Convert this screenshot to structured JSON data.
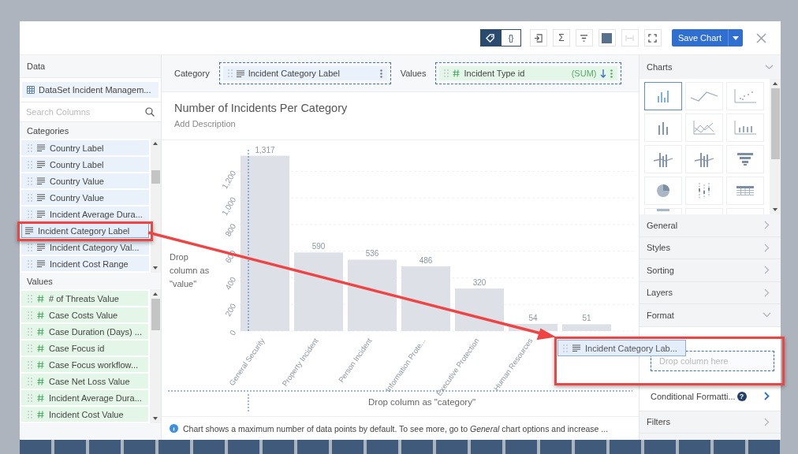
{
  "toolbar": {
    "view_toggle": [
      {
        "kind": "tag",
        "selected": true
      },
      {
        "kind": "braces",
        "label": "{}",
        "selected": false
      }
    ],
    "tools": [
      {
        "kind": "export",
        "disabled": false
      },
      {
        "kind": "sum",
        "label": "Σ",
        "disabled": false
      },
      {
        "kind": "filter",
        "disabled": false
      },
      {
        "kind": "color",
        "disabled": false
      },
      {
        "kind": "width",
        "disabled": true
      },
      {
        "kind": "fullscreen",
        "disabled": false
      }
    ],
    "save_button": "Save Chart"
  },
  "data_panel": {
    "title": "Data",
    "dataset": "DataSet Incident Managem...",
    "search": {
      "placeholder": "Search Columns"
    },
    "categories_heading": "Categories",
    "categories": [
      {
        "label": "Country Label",
        "selected": false
      },
      {
        "label": "Country Label",
        "selected": false
      },
      {
        "label": "Country Value",
        "selected": false
      },
      {
        "label": "Country Value",
        "selected": false
      },
      {
        "label": "Incident Average Dura...",
        "selected": false
      },
      {
        "label": "Incident Category Label",
        "selected": true
      },
      {
        "label": "Incident Category Val...",
        "selected": false
      },
      {
        "label": "Incident Cost Range",
        "selected": false
      }
    ],
    "values_heading": "Values",
    "values": [
      {
        "label": "# of Threats Value",
        "selected": false
      },
      {
        "label": "Case Costs Value",
        "selected": false
      },
      {
        "label": "Case Duration (Days) ...",
        "selected": false
      },
      {
        "label": "Case Focus id",
        "selected": false
      },
      {
        "label": "Case Focus workflow...",
        "selected": false
      },
      {
        "label": "Case Net Loss Value",
        "selected": false
      },
      {
        "label": "Incident Average Dura...",
        "selected": false
      },
      {
        "label": "Incident Cost Value",
        "selected": false
      }
    ]
  },
  "fields_bar": {
    "category_label": "Category",
    "category_field": "Incident Category Label",
    "values_label": "Values",
    "values_field": "Incident Type id",
    "aggregate": "(SUM)"
  },
  "chart": {
    "title": "Number of Incidents Per Category",
    "description": "Add Description",
    "drop_value_hint": "Drop column as \"value\"",
    "drop_category_hint": "Drop column as \"category\"",
    "chart_data": {
      "type": "bar",
      "categories": [
        "General Security",
        "Property Incident",
        "Person Incident",
        "Information Prote...",
        "Executive Protection",
        "Human Resources",
        null
      ],
      "values": [
        1317,
        590,
        536,
        486,
        320,
        54,
        51
      ],
      "ylim": [
        0,
        1350
      ],
      "yticks": [
        0,
        200,
        400,
        600,
        800,
        {
          "value": 1000,
          "label": "1,000"
        },
        {
          "value": 1200,
          "label": "1,200"
        }
      ],
      "value_labels": [
        "1,317",
        "590",
        "536",
        "486",
        "320",
        "54",
        "51"
      ],
      "grid": true
    },
    "note_emphasis": "Chart shows a maximum number of data points by default. To see more, go to *General* chart options and increase ..."
  },
  "charts_panel": {
    "title": "Charts",
    "types": [
      {
        "kind": "column",
        "selected": true
      },
      {
        "kind": "line",
        "selected": false
      },
      {
        "kind": "scatter",
        "selected": false
      },
      {
        "kind": "stacked",
        "selected": false
      },
      {
        "kind": "area",
        "selected": false
      },
      {
        "kind": "dots",
        "selected": false
      },
      {
        "kind": "combo",
        "selected": false
      },
      {
        "kind": "stacked-combo",
        "selected": false
      },
      {
        "kind": "funnel",
        "selected": false
      },
      {
        "kind": "pie",
        "selected": false
      },
      {
        "kind": "box",
        "selected": false
      },
      {
        "kind": "table",
        "selected": false
      },
      {
        "kind": "gauge",
        "selected": false
      },
      {
        "kind": "blank",
        "selected": false
      },
      {
        "kind": "blank",
        "selected": false
      }
    ]
  },
  "sections": [
    {
      "label": "General",
      "expanded": false
    },
    {
      "label": "Styles",
      "expanded": false
    },
    {
      "label": "Sorting",
      "expanded": false
    },
    {
      "label": "Layers",
      "expanded": false
    },
    {
      "label": "Format",
      "expanded": true
    }
  ],
  "drop_field": {
    "placeholder": "Drop column here"
  },
  "conditional": {
    "label": "Conditional Formatti...",
    "help": "?"
  },
  "filters": {
    "label": "Filters",
    "expanded": false
  },
  "drag_chip": "Incident Category Lab..."
}
